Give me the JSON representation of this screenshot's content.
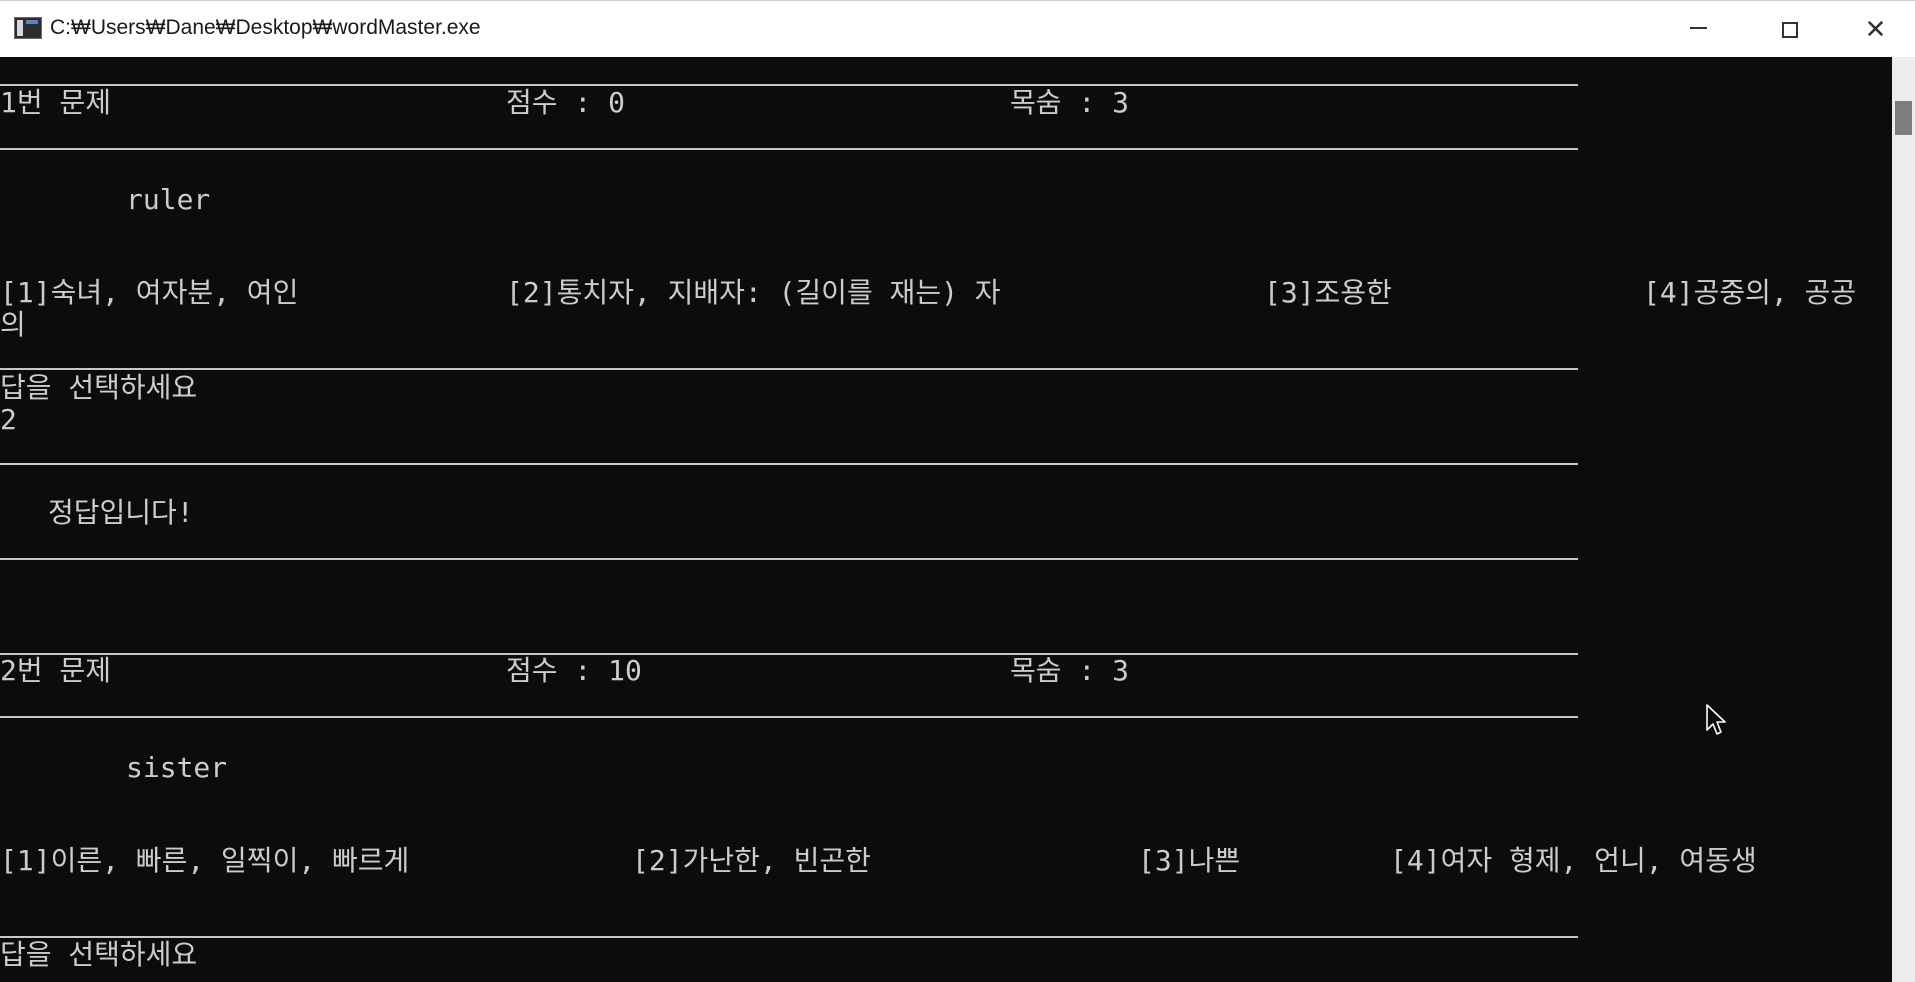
{
  "window": {
    "title": "C:₩Users₩Dane₩Desktop₩wordMaster.exe"
  },
  "console": {
    "q1": {
      "number": "1번 문제",
      "score": "점수 : 0",
      "lives": "목숨 : 3",
      "word": "ruler",
      "options": [
        "[1]숙녀, 여자분, 여인",
        "[2]통치자, 지배자: (길이를 재는) 자",
        "[3]조용한",
        "[4]공중의, 공공"
      ],
      "option_wrap": "의",
      "prompt": "답을 선택하세요",
      "answer": "2",
      "result": "정답입니다!"
    },
    "q2": {
      "number": "2번 문제",
      "score": "점수 : 10",
      "lives": "목숨 : 3",
      "word": "sister",
      "options": [
        "[1]이른, 빠른, 일찍이, 빠르게",
        "[2]가난한, 빈곤한",
        "[3]나쁜",
        "[4]여자 형제, 언니, 여동생"
      ],
      "prompt": "답을 선택하세요"
    }
  }
}
